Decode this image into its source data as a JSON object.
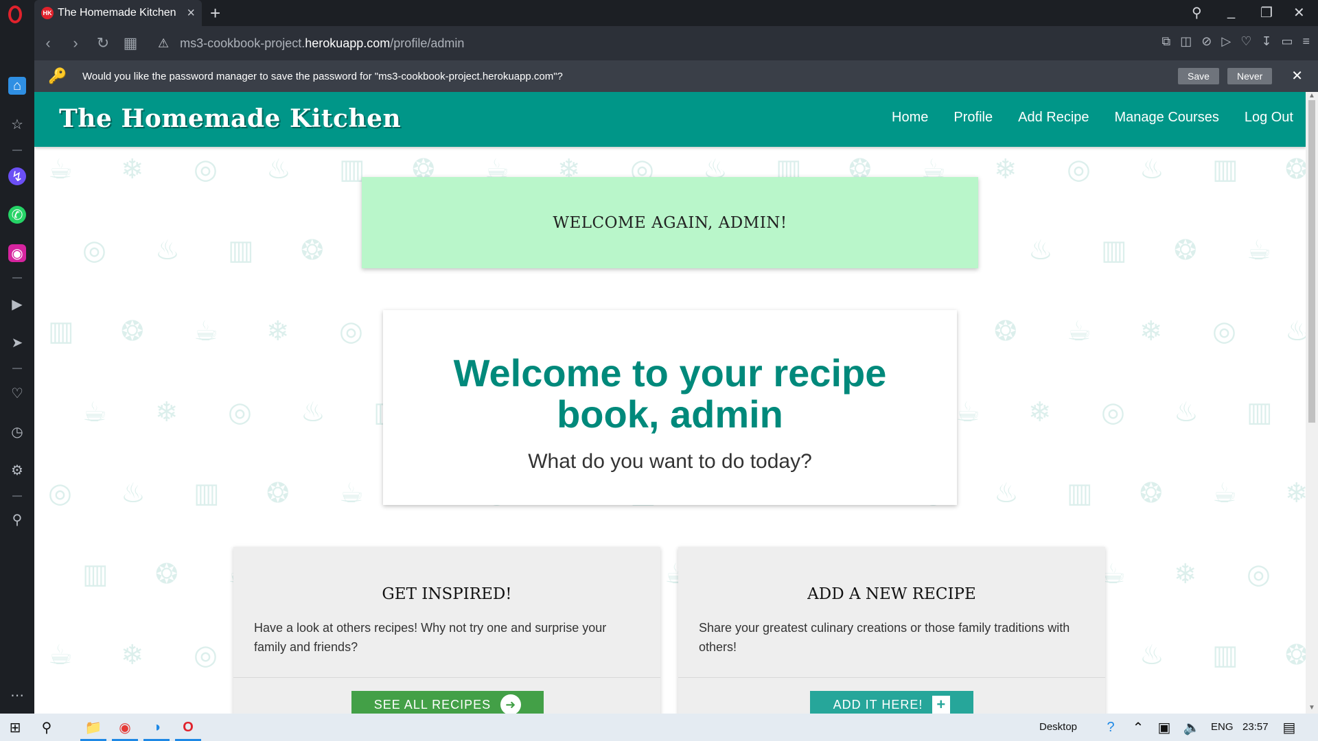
{
  "browser": {
    "tab_title": "The Homemade Kitchen",
    "tab_favicon": "HK",
    "url_prefix": "ms3-cookbook-project.",
    "url_host": "herokuapp.com",
    "url_path": "/profile/admin",
    "password_prompt": "Would you like the password manager to save the password for \"ms3-cookbook-project.herokuapp.com\"?",
    "save_label": "Save",
    "never_label": "Never"
  },
  "site": {
    "brand": "The Homemade Kitchen",
    "nav": [
      "Home",
      "Profile",
      "Add Recipe",
      "Manage Courses",
      "Log Out"
    ],
    "welcome_banner": "WELCOME AGAIN, ADMIN!",
    "hero_title": "Welcome to your recipe book, admin",
    "hero_subtitle": "What do you want to do today?",
    "cards": [
      {
        "title": "GET INSPIRED!",
        "text": "Have a look at others recipes! Why not try one and surprise your family and friends?",
        "button": "SEE ALL RECIPES",
        "button_color": "#43a047"
      },
      {
        "title": "ADD A NEW RECIPE",
        "text": "Share your greatest culinary creations or those family traditions with others!",
        "button": "ADD IT HERE!",
        "button_color": "#26a69a"
      }
    ]
  },
  "taskbar": {
    "desktop_label": "Desktop",
    "language": "ENG",
    "time": "23:57"
  },
  "colors": {
    "nav_teal": "#009688",
    "hero_text": "#00897b",
    "banner_green": "#b9f6ca"
  }
}
